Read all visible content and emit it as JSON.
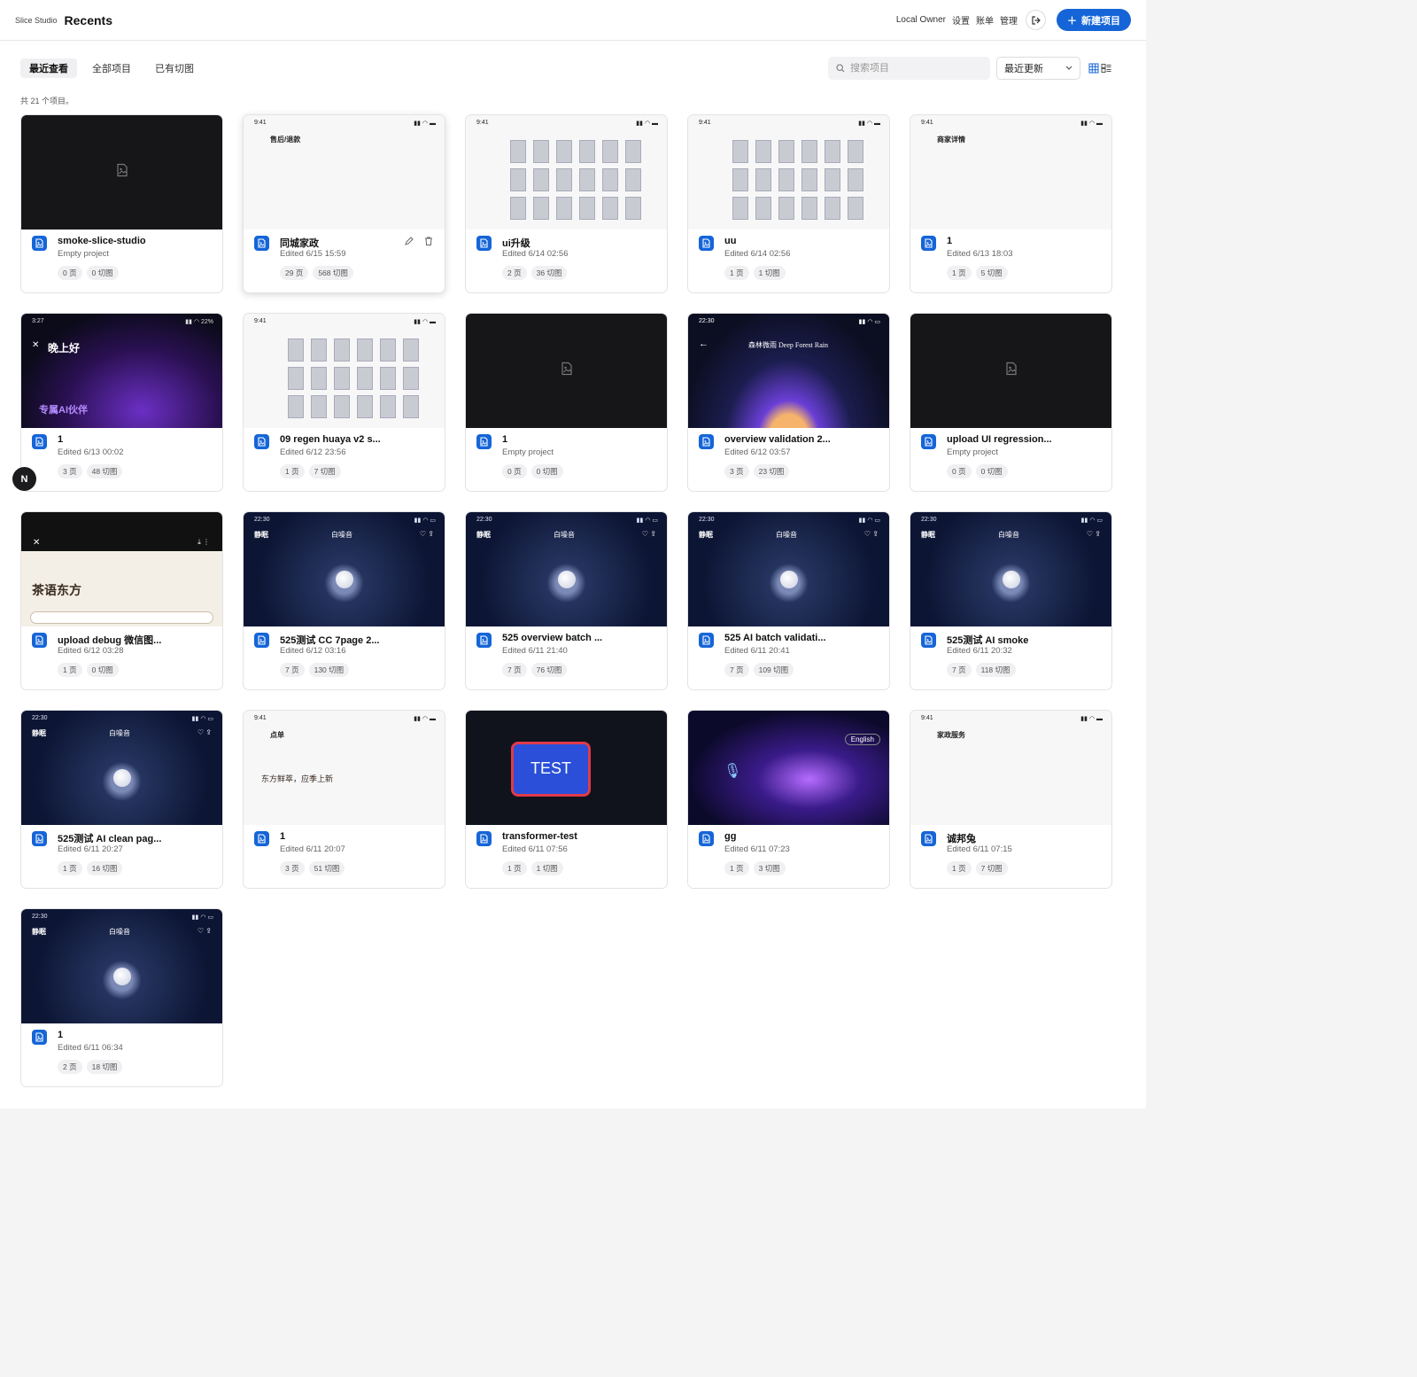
{
  "header": {
    "brand": "Slice Studio",
    "title": "Recents",
    "user": "Local Owner",
    "settings_label": "设置",
    "billing_label": "账单",
    "admin_label": "管理",
    "new_project_label": "新建项目",
    "accent_color": "#1565d8"
  },
  "tabs": [
    {
      "label": "最近查看",
      "active": true
    },
    {
      "label": "全部项目",
      "active": false
    },
    {
      "label": "已有切图",
      "active": false
    }
  ],
  "search": {
    "placeholder": "搜索项目",
    "value": ""
  },
  "sort": {
    "selected": "最近更新"
  },
  "count_text": "共 21 个项目。",
  "fab_label": "N",
  "projects": [
    {
      "name": "smoke-slice-studio",
      "subtitle": "Empty project",
      "pages": "0 页",
      "slices": "0 切图",
      "thumb": "empty"
    },
    {
      "name": "同城家政",
      "subtitle": "Edited 6/15 15:59",
      "pages": "29 页",
      "slices": "568 切图",
      "thumb": "light-aftersale",
      "thumb_text": "售后/退款"
    },
    {
      "name": "ui升级",
      "subtitle": "Edited 6/14 02:56",
      "pages": "2 页",
      "slices": "36 切图",
      "thumb": "light-grid"
    },
    {
      "name": "uu",
      "subtitle": "Edited 6/14 02:56",
      "pages": "1 页",
      "slices": "1 切图",
      "thumb": "light-grid"
    },
    {
      "name": "1",
      "subtitle": "Edited 6/13 18:03",
      "pages": "1 页",
      "slices": "5 切图",
      "thumb": "light-merchant",
      "thumb_text": "商家详情"
    },
    {
      "name": "1",
      "subtitle": "Edited 6/13 00:02",
      "pages": "3 页",
      "slices": "48 切图",
      "thumb": "dark-purple",
      "thumb_text": "晚上好",
      "thumb_text2": "专属AI伙伴"
    },
    {
      "name": "09 regen huaya v2 s...",
      "subtitle": "Edited 6/12 23:56",
      "pages": "1 页",
      "slices": "7 切图",
      "thumb": "light-grid"
    },
    {
      "name": "1",
      "subtitle": "Empty project",
      "pages": "0 页",
      "slices": "0 切图",
      "thumb": "empty"
    },
    {
      "name": "overview validation 2...",
      "subtitle": "Edited 6/12 03:57",
      "pages": "3 页",
      "slices": "23 切图",
      "thumb": "forest",
      "thumb_text": "森林微雨 Deep Forest Rain"
    },
    {
      "name": "upload UI regression...",
      "subtitle": "Empty project",
      "pages": "0 页",
      "slices": "0 切图",
      "thumb": "empty"
    },
    {
      "name": "upload debug 微信图...",
      "subtitle": "Edited 6/12 03:28",
      "pages": "1 页",
      "slices": "0 切图",
      "thumb": "tea",
      "thumb_text": "茶语东方"
    },
    {
      "name": "525测试 CC 7page 2...",
      "subtitle": "Edited 6/12 03:16",
      "pages": "7 页",
      "slices": "130 切图",
      "thumb": "night",
      "thumb_text": "白噪音",
      "thumb_text2": "静眠"
    },
    {
      "name": "525 overview batch ...",
      "subtitle": "Edited 6/11 21:40",
      "pages": "7 页",
      "slices": "76 切图",
      "thumb": "night",
      "thumb_text": "白噪音",
      "thumb_text2": "静眠"
    },
    {
      "name": "525 AI batch validati...",
      "subtitle": "Edited 6/11 20:41",
      "pages": "7 页",
      "slices": "109 切图",
      "thumb": "night",
      "thumb_text": "白噪音",
      "thumb_text2": "静眠"
    },
    {
      "name": "525测试 AI smoke",
      "subtitle": "Edited 6/11 20:32",
      "pages": "7 页",
      "slices": "118 切图",
      "thumb": "night",
      "thumb_text": "白噪音",
      "thumb_text2": "静眠"
    },
    {
      "name": "525测试 AI clean pag...",
      "subtitle": "Edited 6/11 20:27",
      "pages": "1 页",
      "slices": "16 切图",
      "thumb": "night",
      "thumb_text": "白噪音",
      "thumb_text2": "静眠"
    },
    {
      "name": "1",
      "subtitle": "Edited 6/11 20:07",
      "pages": "3 页",
      "slices": "51 切图",
      "thumb": "light-tea",
      "thumb_text": "点单",
      "thumb_text2": "东方鲜萃，应季上新"
    },
    {
      "name": "transformer-test",
      "subtitle": "Edited 6/11 07:56",
      "pages": "1 页",
      "slices": "1 切图",
      "thumb": "test",
      "thumb_text": "TEST"
    },
    {
      "name": "gg",
      "subtitle": "Edited 6/11 07:23",
      "pages": "1 页",
      "slices": "3 切图",
      "thumb": "gg",
      "thumb_text": "English"
    },
    {
      "name": "诚邦兔",
      "subtitle": "Edited 6/11 07:15",
      "pages": "1 页",
      "slices": "7 切图",
      "thumb": "light-home",
      "thumb_text": "家政服务"
    },
    {
      "name": "1",
      "subtitle": "Edited 6/11 06:34",
      "pages": "2 页",
      "slices": "18 切图",
      "thumb": "night",
      "thumb_text": "白噪音",
      "thumb_text2": "静眠"
    }
  ]
}
